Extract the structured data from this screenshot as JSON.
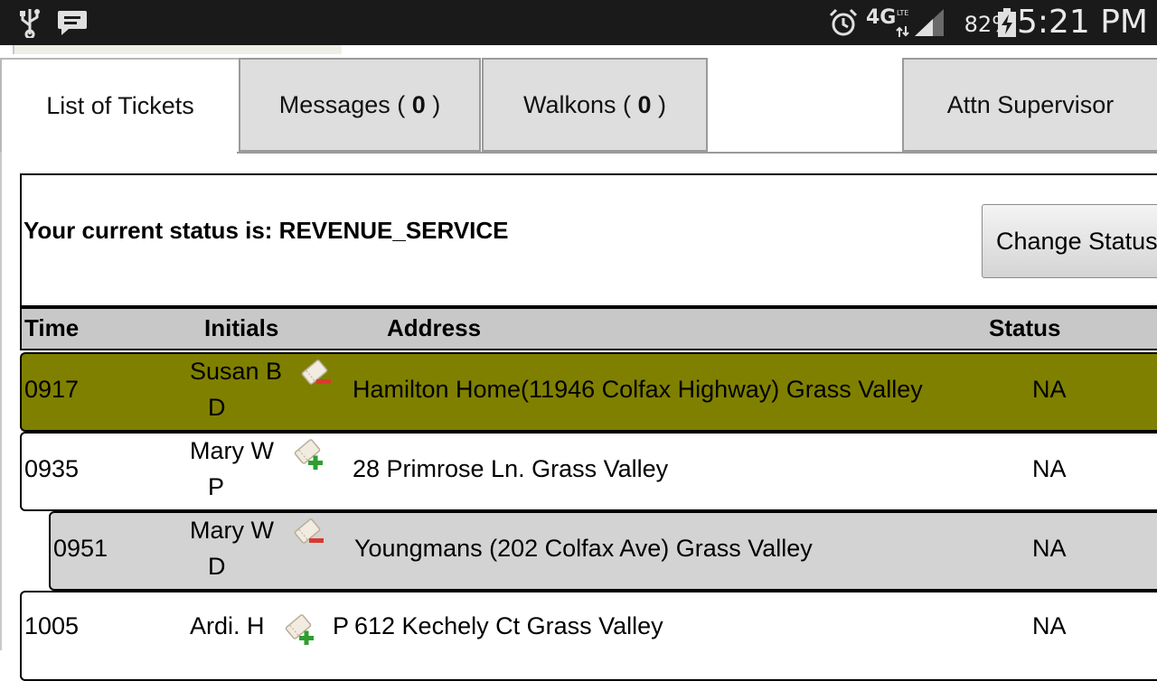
{
  "status_bar": {
    "icons": [
      "usb-icon",
      "chat-bubble-icon",
      "alarm-icon",
      "network-4g-lte-icon",
      "signal-icon",
      "battery-charging-icon"
    ],
    "network_label": "4G",
    "battery_percent": "82%",
    "time": "5:21 PM"
  },
  "tabs": [
    {
      "label": "List of Tickets",
      "active": true
    },
    {
      "label": "Messages ( ",
      "count": "0",
      "suffix": " )"
    },
    {
      "label": "Walkons ( ",
      "count": "0",
      "suffix": " )"
    },
    {
      "label": "Attn Supervisor"
    }
  ],
  "status": {
    "text": "Your current status is: REVENUE_SERVICE",
    "button_label": "Change Status"
  },
  "table": {
    "headers": [
      "Time",
      "Initials",
      "Address",
      "Status"
    ],
    "rows": [
      {
        "time": "0917",
        "initials_1": "Susan B",
        "initials_2": "D",
        "ticket_icon": "ticket-remove-icon",
        "address": "Hamilton Home(11946 Colfax Highway) Grass Valley",
        "status": "NA",
        "bg": "#808000"
      },
      {
        "time": "0935",
        "initials_1": "Mary W",
        "initials_2": "P",
        "ticket_icon": "ticket-add-icon",
        "address": "28 Primrose Ln. Grass Valley",
        "status": "NA",
        "bg": "#ffffff"
      },
      {
        "time": "0951",
        "initials_1": "Mary W",
        "initials_2": "D",
        "ticket_icon": "ticket-remove-icon",
        "address": "Youngmans (202 Colfax Ave) Grass Valley",
        "status": "NA",
        "bg": "#d3d3d3"
      },
      {
        "time": "1005",
        "initials_1": "Ardi. H",
        "initials_2": "P",
        "ticket_icon": "ticket-add-icon",
        "address": "612 Kechely Ct Grass Valley",
        "status": "NA",
        "bg": "#ffffff"
      }
    ]
  }
}
